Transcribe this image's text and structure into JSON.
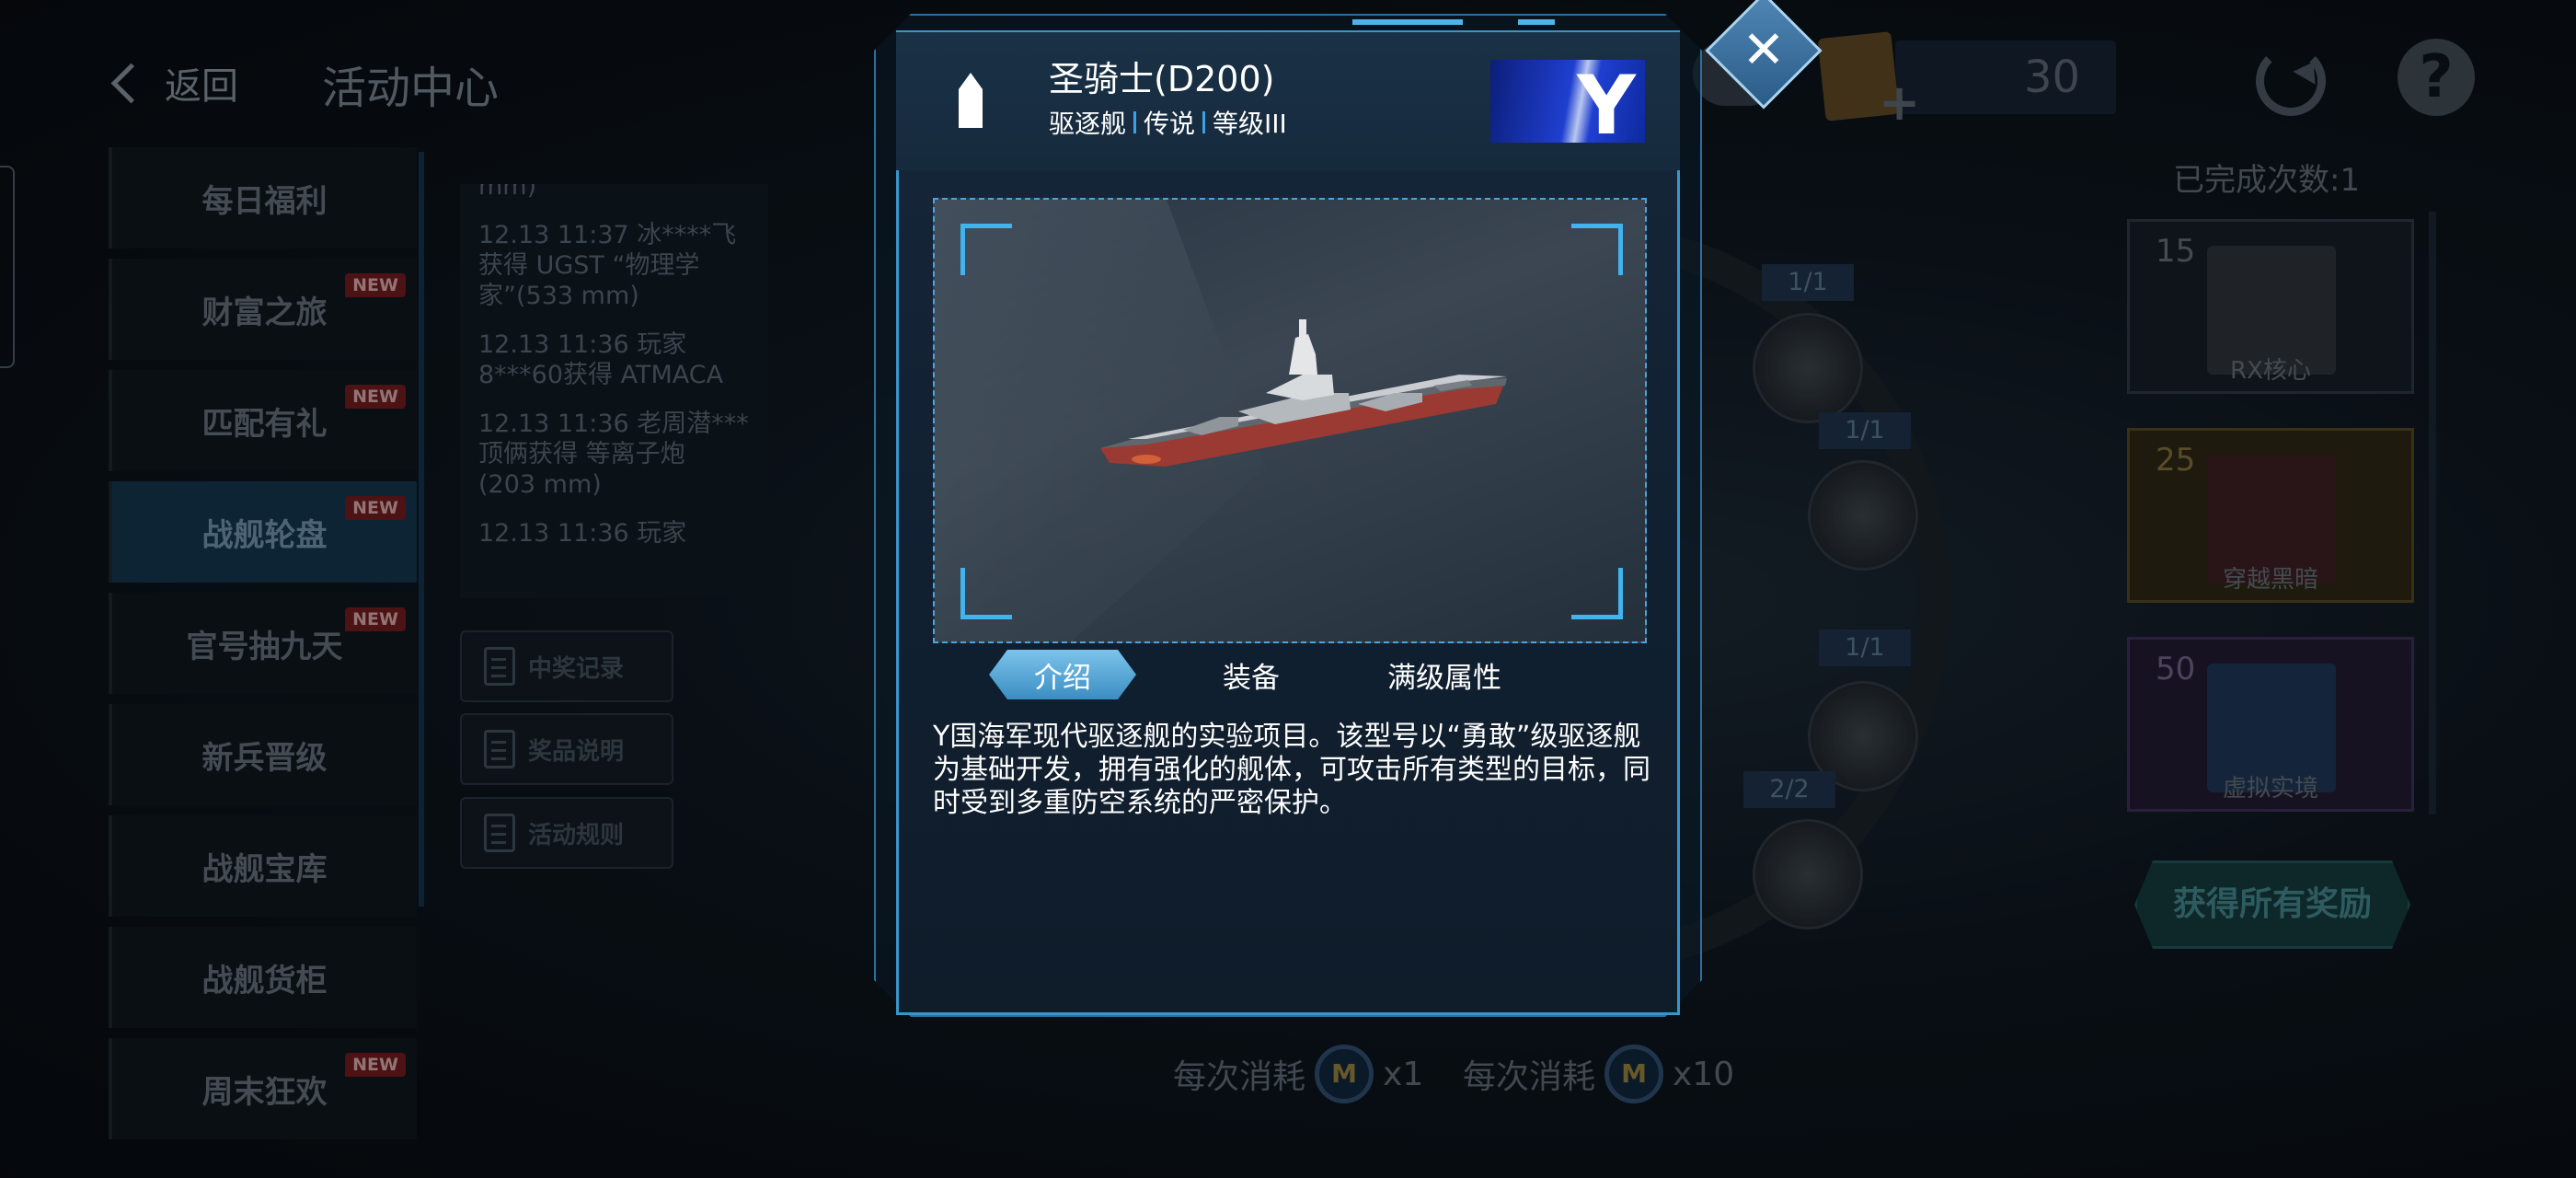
{
  "header": {
    "back_label": "返回",
    "page_title": "活动中心",
    "currency_value": "30"
  },
  "menu": [
    {
      "label": "每日福利",
      "new": ""
    },
    {
      "label": "财富之旅",
      "new": "NEW"
    },
    {
      "label": "匹配有礼",
      "new": "NEW"
    },
    {
      "label": "战舰轮盘",
      "new": "NEW"
    },
    {
      "label": "官号抽九天",
      "new": "NEW"
    },
    {
      "label": "新兵晋级",
      "new": ""
    },
    {
      "label": "战舰宝库",
      "new": ""
    },
    {
      "label": "战舰货柜",
      "new": ""
    },
    {
      "label": "周末狂欢",
      "new": "NEW"
    }
  ],
  "feed": [
    "mm)",
    "12.13 11:37 冰****飞获得 UGST “物理学家”(533 mm)",
    "12.13 11:36 玩家8***60获得 ATMACA",
    "12.13 11:36 老周潜***顶俩获得 等离子炮 (203 mm)",
    "12.13 11:36 玩家"
  ],
  "side_buttons": {
    "records": "中奖记录",
    "prize_info": "奖品说明",
    "rules": "活动规则"
  },
  "wheel_counts": [
    "1/1",
    "1/1",
    "1/1",
    "2/2"
  ],
  "rewards": {
    "done_count": "已完成次数:1",
    "items": [
      {
        "num": "15",
        "label": "RX核心"
      },
      {
        "num": "25",
        "label": "穿越黑暗"
      },
      {
        "num": "50",
        "label": "虚拟实境"
      }
    ],
    "claim_all": "获得所有奖励"
  },
  "costs": {
    "single_label": "每次消耗",
    "single_mult": "x1",
    "ten_label": "每次消耗",
    "ten_mult": "x10"
  },
  "modal": {
    "ship_name": "圣骑士(D200)",
    "ship_type": "驱逐舰",
    "ship_rarity": "传说",
    "ship_level": "等级III",
    "flag_letter": "Y",
    "tabs": [
      "介绍",
      "装备",
      "满级属性"
    ],
    "active_tab": "介绍",
    "description": "Y国海军现代驱逐舰的实验项目。该型号以“勇敢”级驱逐舰为基础开发，拥有强化的舰体，可攻击所有类型的目标，同时受到多重防空系统的严密保护。",
    "close_symbol": "✕"
  },
  "colors": {
    "accent": "#3a95cc",
    "new_badge": "#6a1a1d",
    "flag_blue": "#1f3fd0"
  },
  "icons": {
    "back": "chevron-left-icon",
    "refresh": "refresh-icon",
    "help": "question-icon",
    "ship_class": "destroyer-class-icon",
    "close": "close-icon",
    "coin": "coin-icon"
  }
}
